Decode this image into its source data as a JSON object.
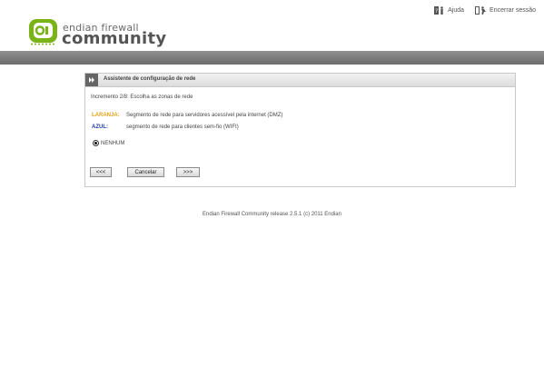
{
  "header": {
    "logo_small": "endian firewall",
    "logo_big": "community",
    "links": {
      "help": "Ajuda",
      "logout": "Encerrar sessão"
    }
  },
  "panel": {
    "title": "Assistente de configuração de rede",
    "step": "Incremento 2/8: Escolha as zonas de rede",
    "zones": [
      {
        "label": "LARANJA:",
        "description": "Segmento de rede para servidores acessível pela internet (DMZ)",
        "color": "#e8a21a"
      },
      {
        "label": "AZUL:",
        "description": "segmento de rede para clientes sem-fio (WIFI)",
        "color": "#1f3fa5"
      }
    ],
    "radio_option": "NENHUM",
    "buttons": {
      "back": "<<<",
      "cancel": "Cancelar",
      "next": ">>>"
    }
  },
  "footer": {
    "text": "Endian Firewall Community release 2.5.1 (c) 2011 Endian"
  },
  "colors": {
    "logo_green": "#7ab317",
    "nav_bar": "#7a7a7a"
  }
}
